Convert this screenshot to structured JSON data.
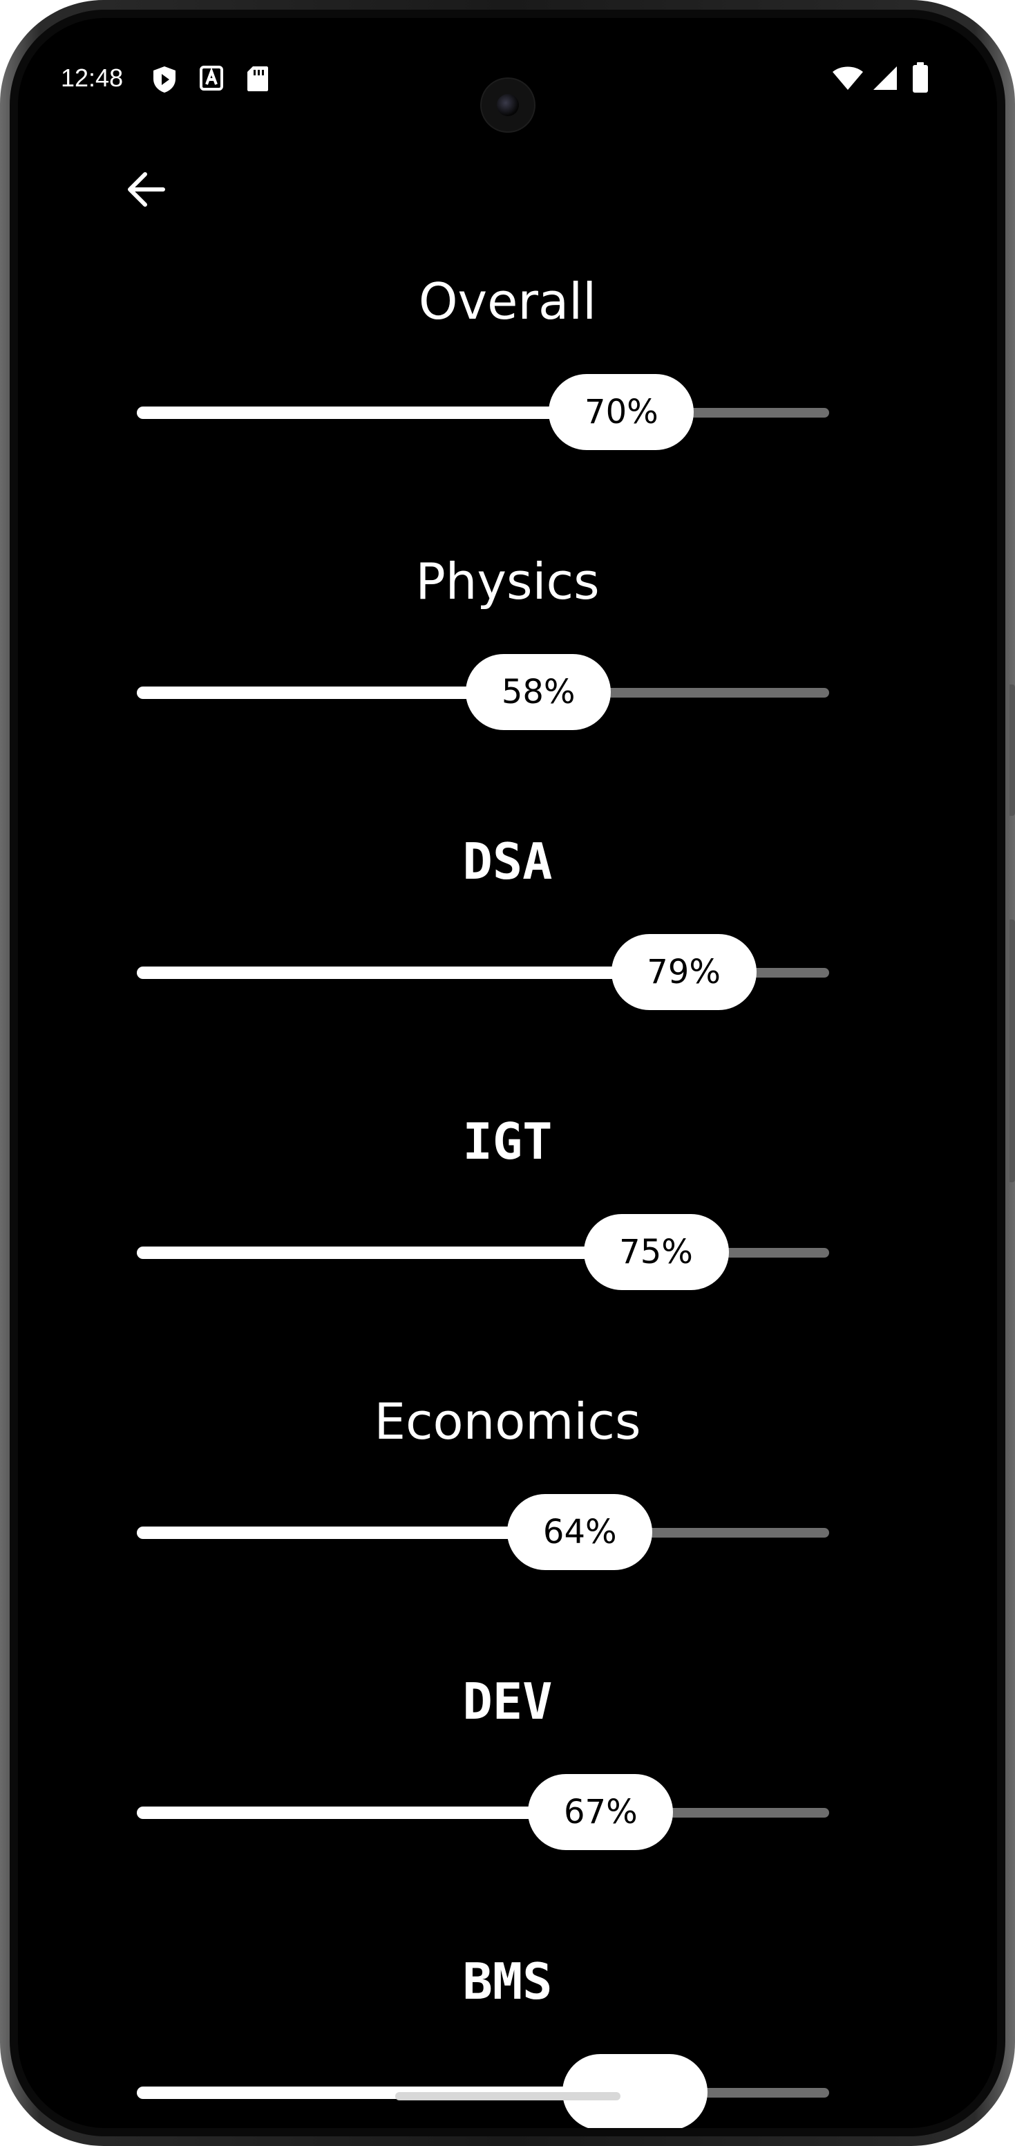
{
  "status_bar": {
    "time": "12:48",
    "left_icons": [
      "play-protect-icon",
      "keyboard-a-icon",
      "sd-card-icon"
    ],
    "right_icons": [
      "wifi-icon",
      "cellular-signal-icon",
      "battery-icon"
    ]
  },
  "header": {
    "back_icon": "arrow-left-icon"
  },
  "subjects": [
    {
      "name": "Overall",
      "percent_label": "70%",
      "value": 0.7
    },
    {
      "name": "Physics",
      "percent_label": "58%",
      "value": 0.58
    },
    {
      "name": "DSA",
      "percent_label": "79%",
      "value": 0.79
    },
    {
      "name": "IGT",
      "percent_label": "75%",
      "value": 0.75
    },
    {
      "name": "Economics",
      "percent_label": "64%",
      "value": 0.64
    },
    {
      "name": "DEV",
      "percent_label": "67%",
      "value": 0.67
    },
    {
      "name": "BMS",
      "percent_label": "",
      "value": 0.72
    }
  ],
  "colors": {
    "background": "#000000",
    "text": "#ffffff",
    "track_active": "#ffffff",
    "track_inactive": "#6e6e6e",
    "thumb": "#ffffff",
    "thumb_text": "#000000"
  }
}
